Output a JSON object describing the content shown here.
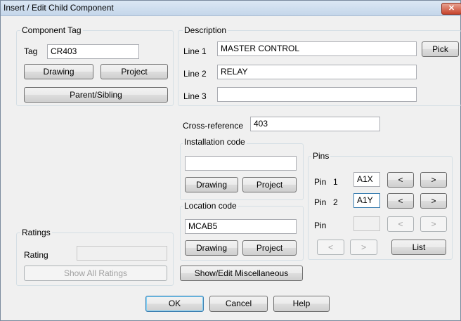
{
  "window": {
    "title": "Insert / Edit Child Component",
    "close_glyph": "✕"
  },
  "component_tag": {
    "legend": "Component Tag",
    "tag_label": "Tag",
    "tag_value": "CR403",
    "drawing_label": "Drawing",
    "project_label": "Project",
    "parent_sibling_label": "Parent/Sibling"
  },
  "description": {
    "legend": "Description",
    "line1_label": "Line 1",
    "line1_value": "MASTER CONTROL",
    "line2_label": "Line 2",
    "line2_value": "RELAY",
    "line3_label": "Line 3",
    "line3_value": "",
    "pick_label": "Pick"
  },
  "cross_reference": {
    "label": "Cross-reference",
    "value": "403"
  },
  "installation_code": {
    "legend": "Installation code",
    "value": "",
    "drawing_label": "Drawing",
    "project_label": "Project"
  },
  "location_code": {
    "legend": "Location code",
    "value": "MCAB5",
    "drawing_label": "Drawing",
    "project_label": "Project"
  },
  "pins": {
    "legend": "Pins",
    "pin1_label": "Pin",
    "pin1_num": "1",
    "pin1_value": "A1X",
    "pin2_label": "Pin",
    "pin2_num": "2",
    "pin2_value": "A1Y",
    "pin3_label": "Pin",
    "pin3_value": "",
    "prev_glyph": "<",
    "next_glyph": ">",
    "list_label": "List"
  },
  "ratings": {
    "legend": "Ratings",
    "rating_label": "Rating",
    "rating_value": "",
    "show_all_label": "Show All Ratings"
  },
  "misc": {
    "show_edit_label": "Show/Edit Miscellaneous"
  },
  "footer": {
    "ok_label": "OK",
    "cancel_label": "Cancel",
    "help_label": "Help"
  }
}
